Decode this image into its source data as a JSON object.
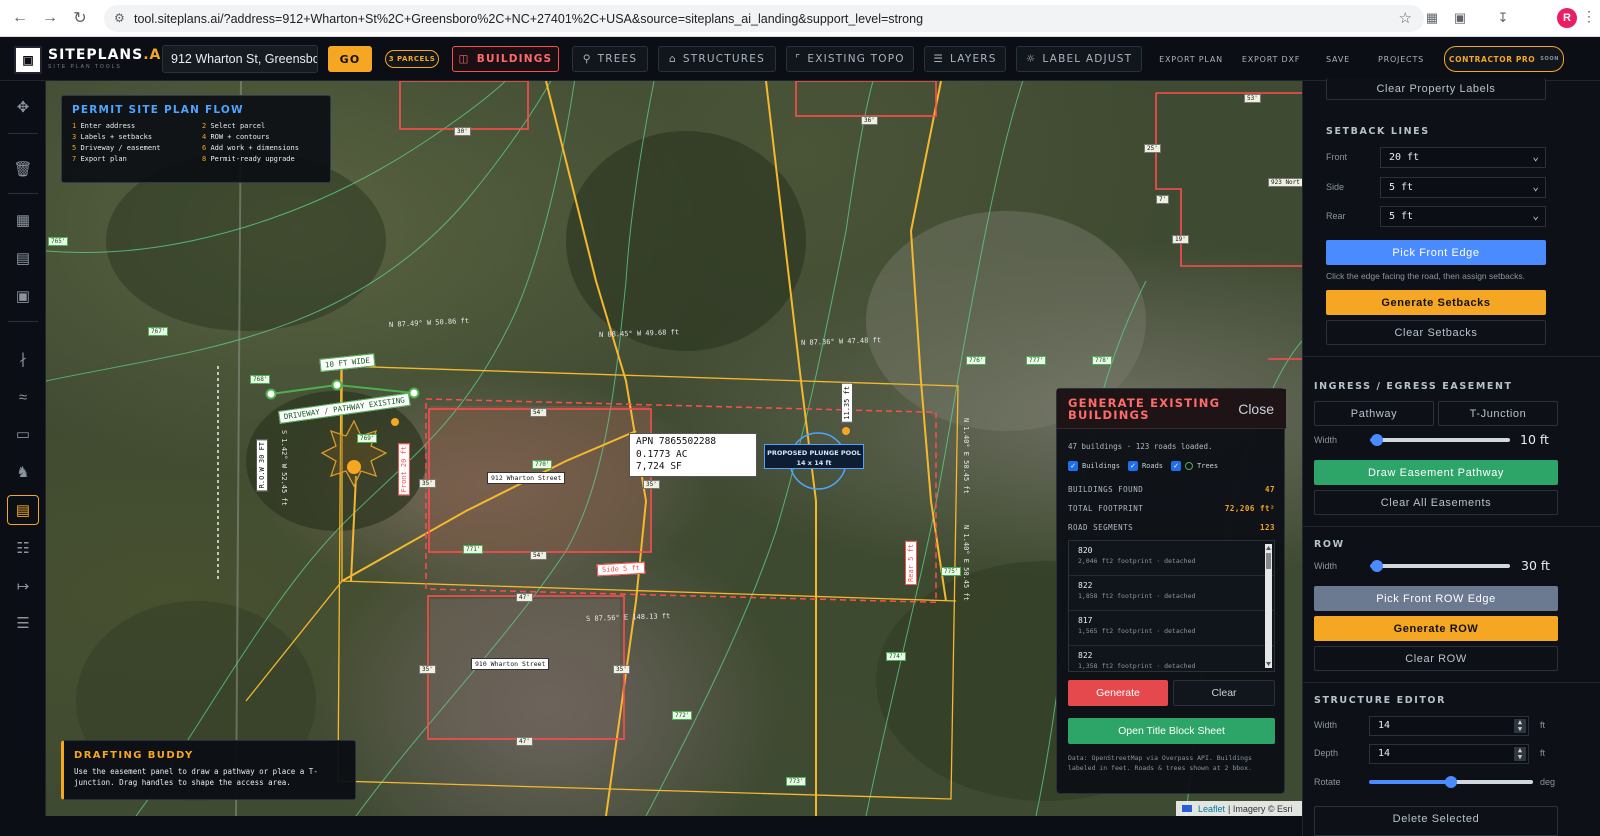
{
  "browser": {
    "url": "tool.siteplans.ai/?address=912+Wharton+St%2C+Greensboro%2C+NC+27401%2C+USA&source=siteplans_ai_landing&support_level=strong",
    "avatar_letter": "R"
  },
  "toolbar": {
    "brand_main": "SITEPLANS",
    "brand_ai": ".AI",
    "brand_sub": "SITE PLAN TOOLS",
    "address_value": "912 Wharton St, Greensboro",
    "go_label": "GO",
    "parcels_label": "3 PARCELS",
    "buildings_label": "BUILDINGS",
    "trees_label": "TREES",
    "structures_label": "STRUCTURES",
    "topo_label": "EXISTING TOPO",
    "layers_label": "LAYERS",
    "label_adjust_label": "LABEL ADJUST",
    "export_plan_label": "EXPORT PLAN",
    "export_dxf_label": "EXPORT DXF",
    "save_label": "SAVE",
    "projects_label": "PROJECTS",
    "pro_label": "CONTRACTOR PRO",
    "pro_soon": "SOON",
    "accent": "#f5a623",
    "active_color": "#ff4d4d"
  },
  "flow": {
    "title": "PERMIT SITE PLAN FLOW",
    "steps": [
      {
        "n": "1",
        "t": "Enter address"
      },
      {
        "n": "2",
        "t": "Select parcel"
      },
      {
        "n": "3",
        "t": "Labels + setbacks"
      },
      {
        "n": "4",
        "t": "ROW + contours"
      },
      {
        "n": "5",
        "t": "Driveway / easement"
      },
      {
        "n": "6",
        "t": "Add work + dimensions"
      },
      {
        "n": "7",
        "t": "Export plan"
      },
      {
        "n": "8",
        "t": "Permit-ready upgrade"
      }
    ]
  },
  "map": {
    "apn_line1": "APN 7865502288",
    "apn_line2": "0.1773 AC",
    "apn_line3": "7,724 SF",
    "pool_line1": "PROPOSED PLUNGE POOL",
    "pool_line2": "14 x 14 ft",
    "house1_label": "912 Wharton Street",
    "house2_label": "910 Wharton Street",
    "row_label": "R.O.W 30 FT",
    "driveway_label": "DRIVEWAY / PATHWAY EXISTING",
    "wide_label": "10 FT WIDE",
    "front_setback": "Front 20 ft",
    "side_setback": "Side 5 ft",
    "rear_setback": "Rear 5 ft",
    "pool_dim": "11.35 ft",
    "bearing_1": "N 87.49° W 50.86 ft",
    "bearing_2": "N 88.45° W 49.68 ft",
    "bearing_3": "N 87.36° W 47.48 ft",
    "bearing_4": "S 87.56° E 148.13 ft",
    "bearing_5": "S 1.42° W 52.45 ft",
    "bearing_6": "N 1.40° E 50.45 ft",
    "bearing_7": "N 1.40° E 50.45 ft",
    "dims": {
      "d30": "30'",
      "d36": "36'",
      "d53": "53'",
      "d25": "25'",
      "d7": "7'",
      "d19": "19'",
      "d54a": "54'",
      "d35a": "35'",
      "d35b": "35'",
      "d54b": "54'",
      "d47a": "47'",
      "d35c": "35'",
      "d35d": "35'",
      "d47b": "47'",
      "d923": "923 Nort"
    },
    "contours": {
      "c765": "765'",
      "c767": "767'",
      "c768": "768'",
      "c769": "769'",
      "c770": "770'",
      "c771": "771'",
      "c772": "772'",
      "c773": "773'",
      "c774": "774'",
      "c775": "775'",
      "c776": "776'",
      "c777": "777'",
      "c778": "778'"
    },
    "attribution_leaflet": "Leaflet",
    "attribution_imagery": "| Imagery © Esri"
  },
  "buddy": {
    "title": "DRAFTING BUDDY",
    "text": "Use the easement panel to draw a pathway or place a T-junction. Drag handles to shape the access area."
  },
  "generate": {
    "title": "GENERATE EXISTING BUILDINGS",
    "close_label": "Close",
    "loaded_text": "47 buildings · 123 roads loaded.",
    "cb_buildings": "Buildings",
    "cb_roads": "Roads",
    "cb_trees": "Trees",
    "buildings_found_label": "BUILDINGS FOUND",
    "buildings_found_value": "47",
    "footprint_label": "TOTAL FOOTPRINT",
    "footprint_value": "72,206 ft²",
    "road_segments_label": "ROAD SEGMENTS",
    "road_segments_value": "123",
    "items": [
      {
        "id": "820",
        "desc": "2,046 ft2 footprint · detached"
      },
      {
        "id": "822",
        "desc": "1,858 ft2 footprint · detached"
      },
      {
        "id": "817",
        "desc": "1,565 ft2 footprint · detached"
      },
      {
        "id": "822",
        "desc": "1,358 ft2 footprint · detached"
      }
    ],
    "generate_label": "Generate",
    "clear_label": "Clear",
    "title_block_label": "Open Title Block Sheet",
    "note": "Data: OpenStreetMap via Overpass API. Buildings labeled in feet. Roads & trees shown at 2 bbox."
  },
  "right": {
    "clear_labels": "Clear Property Labels",
    "setback_title": "SETBACK LINES",
    "front_label": "Front",
    "front_value": "20 ft",
    "side_label": "Side",
    "side_value": "5 ft",
    "rear_label": "Rear",
    "rear_value": "5 ft",
    "pick_front": "Pick Front Edge",
    "pick_hint": "Click the edge facing the road, then assign setbacks.",
    "generate_setbacks": "Generate Setbacks",
    "clear_setbacks": "Clear Setbacks",
    "ingress_title": "INGRESS / EGRESS EASEMENT",
    "pathway_label": "Pathway",
    "tjunction_label": "T-Junction",
    "width_label": "Width",
    "easement_width": "10 ft",
    "easement_width_frac": 0.05,
    "draw_easement": "Draw Easement Pathway",
    "clear_easements": "Clear All Easements",
    "row_title": "ROW",
    "row_width_label": "Width",
    "row_width": "30 ft",
    "row_width_frac": 0.05,
    "pick_row": "Pick Front ROW Edge",
    "generate_row": "Generate ROW",
    "clear_row": "Clear ROW",
    "structure_title": "STRUCTURE EDITOR",
    "s_width_label": "Width",
    "s_width_value": "14",
    "s_width_unit": "ft",
    "s_depth_label": "Depth",
    "s_depth_value": "14",
    "s_depth_unit": "ft",
    "rotate_label": "Rotate",
    "rotate_unit": "deg",
    "rotate_frac": 0.5,
    "delete_selected": "Delete Selected"
  }
}
